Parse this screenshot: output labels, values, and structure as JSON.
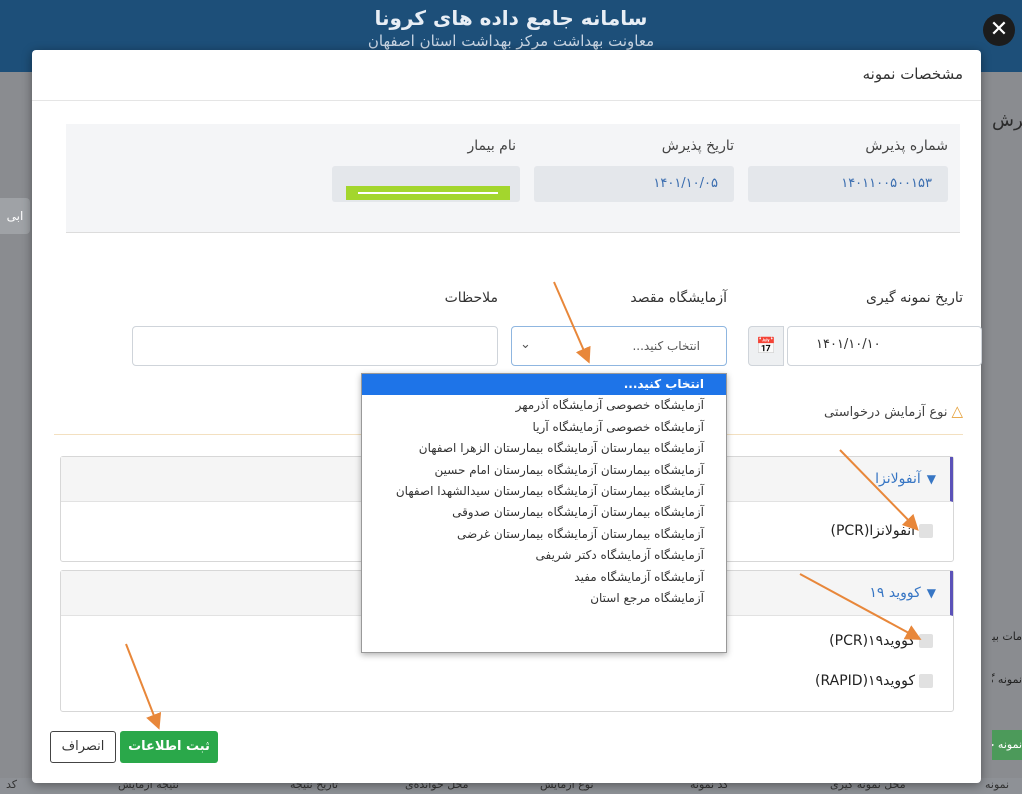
{
  "background": {
    "header_title": "سامانه جامع داده های کرونا",
    "header_subtitle": "معاونت بهداشت مرکز بهداشت استان اصفهان",
    "right_title": "پذیرش",
    "left_tab": "ابی",
    "right_label_1": "مات بیمار",
    "right_label_2": "نمونه گیری",
    "right_button": "نمونه جدید",
    "table_headers": [
      "کد",
      "نتیجه آزمایش",
      "تاریخ نتیجه",
      "محل خوانده‌ی",
      "نوع آزمایش",
      "کد نمونه",
      "محل نمونه گیری",
      "نمونه"
    ]
  },
  "modal": {
    "title": "مشخصات نمونه",
    "info": {
      "reception_number_label": "شماره پذیرش",
      "reception_number": "۱۴۰۱۱۰۰۵۰۰۱۵۳",
      "reception_date_label": "تاریخ پذیرش",
      "reception_date": "۱۴۰۱/۱۰/۰۵",
      "patient_name_label": "نام بیمار"
    },
    "form": {
      "sampling_date_label": "تاریخ نمونه گیری",
      "sampling_date": "۱۴۰۱/۱۰/۱۰",
      "destination_lab_label": "آزمایشگاه مقصد",
      "destination_lab_value": "انتخاب کنید...",
      "notes_label": "ملاحظات",
      "notes_value": ""
    },
    "dropdown_options": [
      "انتخاب کنید...",
      "آزمایشگاه خصوصی آزمایشگاه آذرمهر",
      "آزمایشگاه خصوصی آزمایشگاه آریا",
      "آزمایشگاه بیمارستان آزمایشگاه بیمارستان الزهرا اصفهان",
      "آزمایشگاه بیمارستان آزمایشگاه بیمارستان امام حسین",
      "آزمایشگاه بیمارستان آزمایشگاه بیمارستان سیدالشهدا اصفهان",
      "آزمایشگاه بیمارستان آزمایشگاه بیمارستان صدوقی",
      "آزمایشگاه بیمارستان آزمایشگاه بیمارستان غرضی",
      "آزمایشگاه آزمایشگاه دکتر شریفی",
      "آزمایشگاه آزمایشگاه مفید",
      "آزمایشگاه مرجع استان"
    ],
    "requested_test_label": "نوع آزمایش درخواستی",
    "groups": [
      {
        "title": "آنفولانزا",
        "options": [
          "آنفولانزا(PCR)"
        ]
      },
      {
        "title": "کووید ۱۹",
        "options": [
          "کووید۱۹(PCR)",
          "کووید۱۹(RAPID)"
        ]
      }
    ],
    "buttons": {
      "save": "ثبت اطلاعات",
      "cancel": "انصراف"
    },
    "close_glyph": "✕"
  },
  "colors": {
    "save_button": "#2aa84a",
    "dropdown_selected": "#1e74e8",
    "group_accent": "#5b52b8",
    "annotation_arrow": "#e8873a"
  }
}
